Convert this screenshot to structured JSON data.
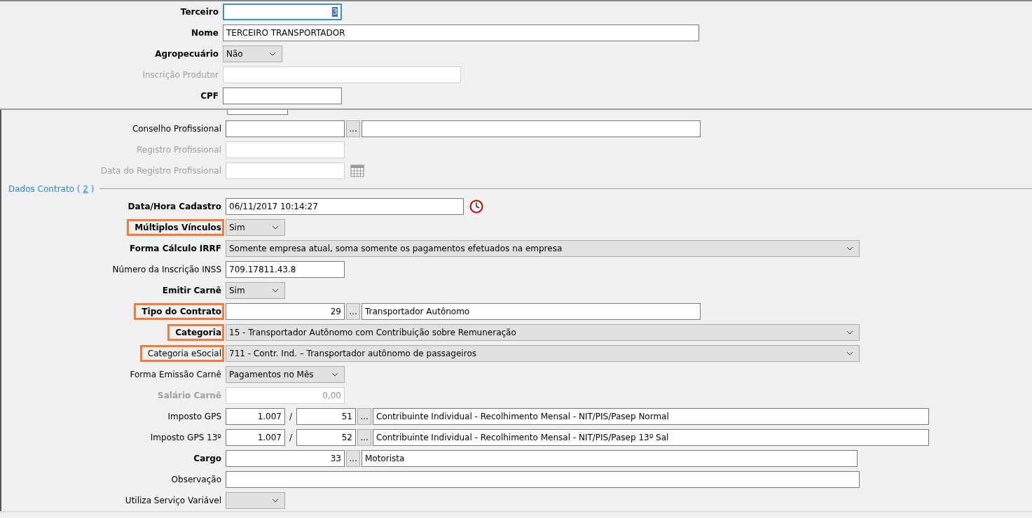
{
  "top_form": {
    "rows": [
      {
        "label": "Terceiro",
        "bold": true,
        "disabled": false,
        "kind": "number",
        "value": "3",
        "focused": true
      },
      {
        "label": "Nome",
        "bold": true,
        "disabled": false,
        "kind": "text",
        "value": "TERCEIRO TRANSPORTADOR"
      },
      {
        "label": "Agropecuário",
        "bold": true,
        "disabled": false,
        "kind": "select",
        "value": "Não"
      },
      {
        "label": "Inscrição Produtor",
        "bold": false,
        "disabled": true,
        "kind": "text"
      },
      {
        "label": "CPF",
        "bold": true,
        "disabled": false,
        "kind": "text"
      }
    ]
  },
  "lower_form": {
    "rows": [
      {
        "kind": "sliver"
      },
      {
        "label": "Conselho Profissional",
        "bold": false,
        "disabled": false,
        "highlighted": false,
        "kind": "lookup",
        "button": "..."
      },
      {
        "label": "Registro Profissional",
        "bold": false,
        "disabled": true,
        "highlighted": false,
        "kind": "text"
      },
      {
        "label": "Data do Registro Profissional",
        "bold": false,
        "disabled": true,
        "highlighted": false,
        "kind": "date"
      },
      {
        "kind": "section",
        "title": "Dados Contrato (",
        "shortcut": "2",
        "close": ")"
      },
      {
        "label": "Data/Hora Cadastro",
        "bold": true,
        "disabled": false,
        "highlighted": false,
        "kind": "datetime",
        "value": "06/11/2017 10:14:27"
      },
      {
        "label": "Múltiplos Vínculos",
        "bold": true,
        "disabled": false,
        "highlighted": true,
        "kind": "select",
        "value": "Sim"
      },
      {
        "label": "Forma Cálculo IRRF",
        "bold": true,
        "disabled": false,
        "highlighted": false,
        "kind": "select",
        "value": "Somente empresa atual, soma somente os pagamentos efetuados na empresa"
      },
      {
        "label": "Número da Inscrição INSS",
        "bold": false,
        "disabled": false,
        "highlighted": false,
        "kind": "text",
        "value": "709.17811.43.8"
      },
      {
        "label": "Emitir Carnê",
        "bold": true,
        "disabled": false,
        "highlighted": false,
        "kind": "select",
        "value": "Sim"
      },
      {
        "label": "Tipo do Contrato",
        "bold": true,
        "disabled": false,
        "highlighted": true,
        "kind": "lookup",
        "value": "29",
        "button": "...",
        "description": "Transportador Autônomo"
      },
      {
        "label": "Categoria",
        "bold": true,
        "disabled": false,
        "highlighted": true,
        "kind": "select",
        "value": "15 - Transportador Autônomo com Contribuição sobre Remuneração"
      },
      {
        "label": "Categoria eSocial",
        "bold": false,
        "disabled": false,
        "highlighted": true,
        "kind": "select",
        "value": "711 - Contr. Ind. – Transportador autônomo de passageiros"
      },
      {
        "label": "Forma Emissão Carnê",
        "bold": false,
        "disabled": false,
        "highlighted": false,
        "kind": "select",
        "value": "Pagamentos no Mês"
      },
      {
        "label": "Salário Carnê",
        "bold": true,
        "disabled": true,
        "highlighted": false,
        "kind": "number",
        "value": "0,00"
      },
      {
        "label": "Imposto GPS",
        "bold": false,
        "disabled": false,
        "highlighted": false,
        "kind": "gps",
        "value": "1.007",
        "separator": "/",
        "code": "51",
        "button": "...",
        "description": "Contribuinte Individual - Recolhimento Mensal - NIT/PIS/Pasep Normal"
      },
      {
        "label": "Imposto GPS 13º",
        "bold": false,
        "disabled": false,
        "highlighted": false,
        "kind": "gps",
        "value": "1.007",
        "separator": "/",
        "code": "52",
        "button": "...",
        "description": "Contribuinte Individual - Recolhimento Mensal - NIT/PIS/Pasep 13º Sal"
      },
      {
        "label": "Cargo",
        "bold": true,
        "disabled": false,
        "highlighted": false,
        "kind": "lookup",
        "value": "33",
        "button": "...",
        "description": "Motorista"
      },
      {
        "label": "Observação",
        "bold": false,
        "disabled": false,
        "highlighted": false,
        "kind": "text"
      },
      {
        "label": "Utiliza Serviço Variável",
        "bold": false,
        "disabled": false,
        "highlighted": false,
        "kind": "select"
      }
    ]
  }
}
